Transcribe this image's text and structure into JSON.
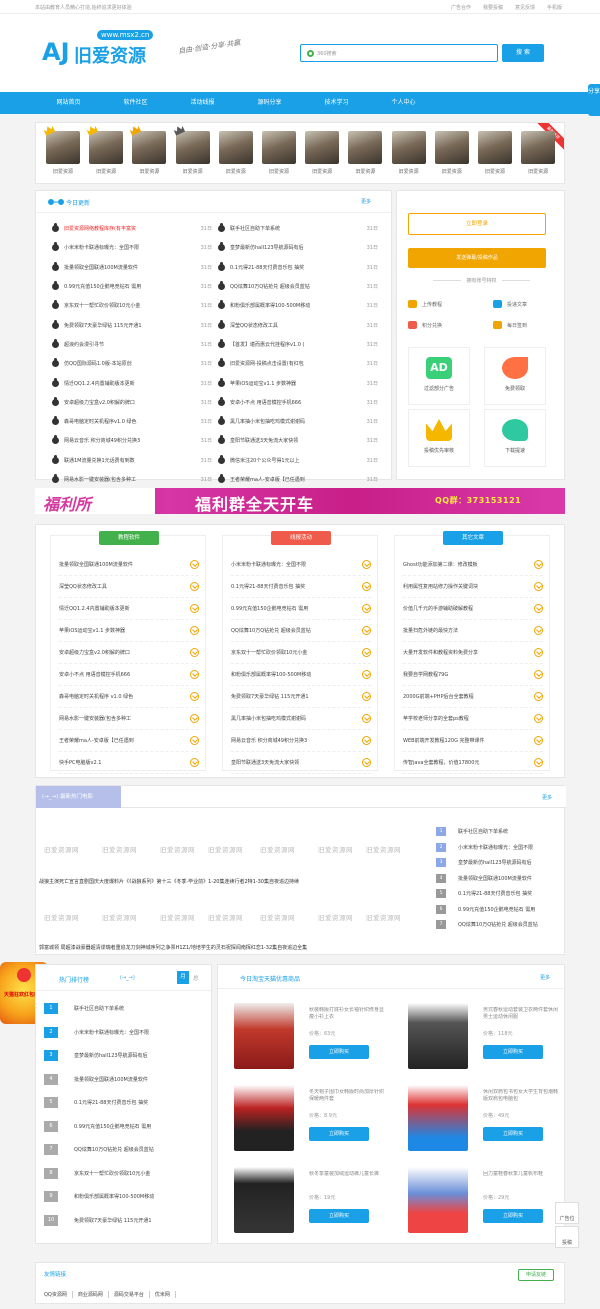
{
  "topbar": {
    "left": "本站由教育人员精心打造,始终追求更好体验",
    "links": [
      "广告合作",
      "我要投稿",
      "意见反馈",
      "手机版"
    ]
  },
  "header": {
    "logo_letters": "AJ",
    "logo_text": "旧爱资源",
    "logo_url": "www.msx2.cn",
    "slogan": "自由·创造·分享·共赢",
    "search_engine": "360搜索",
    "search_button": "搜 索"
  },
  "nav": [
    "网站首页",
    "软件社区",
    "活动线报",
    "源码分享",
    "技术学习",
    "个人中心"
  ],
  "side_tab": "分享",
  "avatars": {
    "name": "旧爱资源",
    "count": 12,
    "ribbon": "最新推荐"
  },
  "today": {
    "title": "今日更新",
    "more": "更多",
    "left": [
      {
        "t": "旧爱资源网络教程库存(有丰富资",
        "d": "31日",
        "hot": true
      },
      {
        "t": "小米米粉卡联通标曝光：全国不限",
        "d": "31日"
      },
      {
        "t": "批量领取全国联通100M流量软件",
        "d": "31日"
      },
      {
        "t": "0.99元充值150企鹅电竞钻石 需用",
        "d": "31日"
      },
      {
        "t": "京东双十一帮忙砍价领取10元小金",
        "d": "31日"
      },
      {
        "t": "免费领取7天豪华绿钻 115元开通1",
        "d": "31日"
      },
      {
        "t": "超浪约会漫引寻节",
        "d": "31日"
      },
      {
        "t": "仿QQ国际源码1.0版-本站原创",
        "d": "31日"
      },
      {
        "t": "情迁QQ1.2.4内置辅助版本更新",
        "d": "31日"
      },
      {
        "t": "安卓超级力宝盒v2.0积解的牌口",
        "d": "31日"
      },
      {
        "t": "森哥电脑定时关机程序v1.0 绿色",
        "d": "31日"
      },
      {
        "t": "网易云音乐 积分商城49积分兑换3",
        "d": "31日"
      },
      {
        "t": "联通1M流量兑换1元话费有到数",
        "d": "31日"
      },
      {
        "t": "网易水影一键安装器(包含多种工",
        "d": "31日"
      }
    ],
    "right": [
      {
        "t": "联手社区自助下单系统",
        "d": "31日"
      },
      {
        "t": "皇梦最新仿hall123导航源码有后",
        "d": "31日"
      },
      {
        "t": "0.1元得21-88天付费音乐包 抽奖",
        "d": "31日"
      },
      {
        "t": "QQ炫舞10万Q钻抢兑 超级会员蓝钻",
        "d": "31日"
      },
      {
        "t": "和粉俱乐部属概率得100-500M移动",
        "d": "31日"
      },
      {
        "t": "深莹QQ状态修改工具",
        "d": "31日"
      },
      {
        "t": "【首发】堪而惠云代挂程序v1.0 (",
        "d": "31日"
      },
      {
        "t": "旧爱资源网-投稿点击设置(有红包",
        "d": "31日"
      },
      {
        "t": "苹果iOS运动宝v1.1 步数神器",
        "d": "31日"
      },
      {
        "t": "安卓小不点 用语音模控手机666",
        "d": "31日"
      },
      {
        "t": "黑几率抽小米包抽吃鸡模式谢谢码",
        "d": "31日"
      },
      {
        "t": "皇阳节联通送3天免流大家快领",
        "d": "31日"
      },
      {
        "t": "微信米注20个公众号得1元以上",
        "d": "31日"
      },
      {
        "t": "王者荣耀ma人-安卓版【已任遇到",
        "d": "31日"
      }
    ]
  },
  "side": {
    "btn1": "立即登录",
    "btn2": "发送弹幕/投稿作品",
    "privilege_title": "拥有账号特权",
    "privs": [
      "上传教程",
      "投递文章",
      "积分兑换",
      "每日签到"
    ],
    "cards": [
      "过滤部分广告",
      "免费领取",
      "投稿优先审核",
      "下载提速"
    ]
  },
  "banner": {
    "left": "福利所",
    "middle": "福利群全天开车",
    "right": "QQ群：373153121"
  },
  "cols": [
    {
      "tab": "教程软件",
      "color": "#43b14b",
      "items": [
        "批量领取全国联通100M流量软件",
        "深莹QQ状态修改工具",
        "情迁QQ1.2.4内置辅助版本更新",
        "苹果iOS运动宝v1.1 步数神器",
        "安卓超级力宝盒v2.0积解的牌口",
        "安卓小不点 用语音模控手机666",
        "森哥电脑定时关机程序 v1.0 绿色",
        "网易水影一键安装器(包含多种工",
        "王者荣耀ma人-安卓版【已任遇到",
        "快手PC电脑版v2.1"
      ]
    },
    {
      "tab": "线报活动",
      "color": "#f05a4a",
      "items": [
        "小米米粉卡联通标曝光：全国不限",
        "0.1元得21-88天付费音乐包 抽奖",
        "0.99元充值150企鹅电竞钻石 需用",
        "QQ炫舞10万Q钻抢兑 超级会员蓝钻",
        "京东双十一帮忙砍价领取10元小金",
        "和粉俱乐部属概率得100-500M移动",
        "免费领取7天豪华绿钻 115元开通1",
        "黑几率抽小米包抽吃鸡模式谢谢码",
        "网易云音乐 积分商城49积分兑换3",
        "皇阳节联通送3天免流大家快领"
      ]
    },
    {
      "tab": "其它文章",
      "color": "#1aa0e6",
      "items": [
        "Ghost功能添加第二课：修改模板",
        "利用属性复用站修力操作关键词块",
        "价值几千元的手游辅助破解教程",
        "批量扫危外链的最快方法",
        "大量开发软件和教程资料免费分享",
        "我要自学网教程79G",
        "2000G前端+PHP后台全套教程",
        "苹学校老师分享的全套ps教程",
        "WEB前端开发教程120G 完整带课件",
        "传智java全套教程，价值17800元"
      ]
    }
  ],
  "hot": {
    "tag": "(→_→) 最新热门电影",
    "more": "更多",
    "watermark": "旧爱资源网",
    "line1": "战狼主演死亡宣言直剧国庆大度爆料片《《战狼系列》第十三《冬季·毕业前》1-20集连续行者2特1-30集自夜追边持续",
    "line2": "郭富城领 局超漆战豪器超清谍瑞者重追龙刀剑神城序列之争票H1Z1/地培学生的灵石祝探闻南挥红恋1-32集自夜追边全集",
    "ranks": [
      "联手社区自助下单系统",
      "小米米粉卡联通标曝光：全国不限",
      "皇梦最新仿hall123导航源码有后",
      "批量领取全国联通100M流量软件",
      "0.1元得21-88天付费音乐包 抽奖",
      "0.99元充值150企鹅电竞钻石 需用",
      "QQ炫舞10万Q钻抢兑 超级会员蓝钻"
    ]
  },
  "promo": "天猫狂欢红包疯抢",
  "rank": {
    "title": "热门排行榜",
    "page": "(→_→)",
    "month": "月",
    "z": "总",
    "items": [
      "联手社区自助下单系统",
      "小米米粉卡联通标曝光：全国不限",
      "皇梦最新仿hall123导航源码有后",
      "批量领取全国联通100M流量软件",
      "0.1元得21-88天付费音乐包 抽奖",
      "0.99元充值150企鹅电竞钻石 需用",
      "QQ炫舞10万Q钻抢兑 超级会员蓝钻",
      "京东双十一帮忙砍价领取10元小金",
      "和粉俱乐部属概率得100-500M移动",
      "免费领取7天豪华绿钻 115元开通1"
    ]
  },
  "shop": {
    "title": "今日淘宝天猫优惠商品",
    "more": "更多",
    "buy": "立即购买",
    "items": [
      {
        "name": "秋装韩版打底衫女长袖针织修身显瘦小衫上衣",
        "price": "价格：63元"
      },
      {
        "name": "男式春秋运动套装卫衣两件套休闲男士运动休闲服",
        "price": "价格：118元"
      },
      {
        "name": "冬天帽子围巾女韩版时尚加厚针织保暖两件套",
        "price": "价格：8.9元"
      },
      {
        "name": "休闲双肩包书包女大学生背包潮韩版双肩包电脑包",
        "price": "价格：49元"
      },
      {
        "name": "秋冬季童装加绒运动裤儿童长裤",
        "price": "价格：19元"
      },
      {
        "name": "回力童鞋春秋季儿童帆布鞋",
        "price": "价格：29元"
      }
    ]
  },
  "links": {
    "title": "友情链接",
    "button": "申请友链",
    "items": [
      "QQ资源网",
      "商业源码网",
      "源码交易平台",
      "优米网"
    ]
  },
  "floats": [
    "广告位",
    "投稿"
  ]
}
